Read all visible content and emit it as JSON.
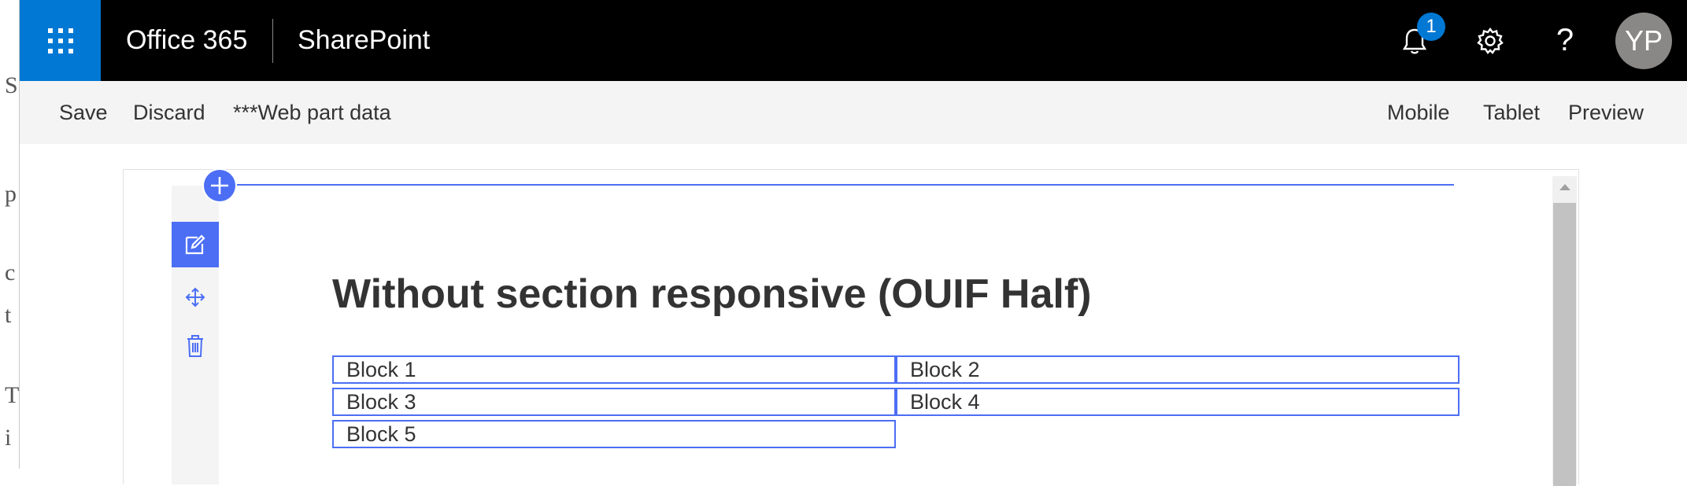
{
  "suite_bar": {
    "brand": "Office 365",
    "app_name": "SharePoint",
    "notification_count": "1",
    "help_label": "?",
    "avatar_initials": "YP"
  },
  "command_bar": {
    "left": [
      "Save",
      "Discard",
      "***Web part data"
    ],
    "right": [
      "Mobile",
      "Tablet",
      "Preview"
    ]
  },
  "canvas": {
    "heading": "Without section responsive (OUIF Half)",
    "blocks": [
      "Block 1",
      "Block 2",
      "Block 3",
      "Block 4",
      "Block 5"
    ]
  },
  "icons": {
    "app_launcher": "waffle-icon",
    "notifications": "bell-icon",
    "settings": "gear-icon",
    "help": "help-icon",
    "add_section": "plus-icon",
    "edit": "edit-icon",
    "move": "move-icon",
    "delete": "trash-icon"
  },
  "colors": {
    "suite_bar": "#000000",
    "app_launcher": "#0078d4",
    "accent": "#4c6ef5",
    "command_bar": "#f4f4f4",
    "avatar": "#8a8886"
  }
}
